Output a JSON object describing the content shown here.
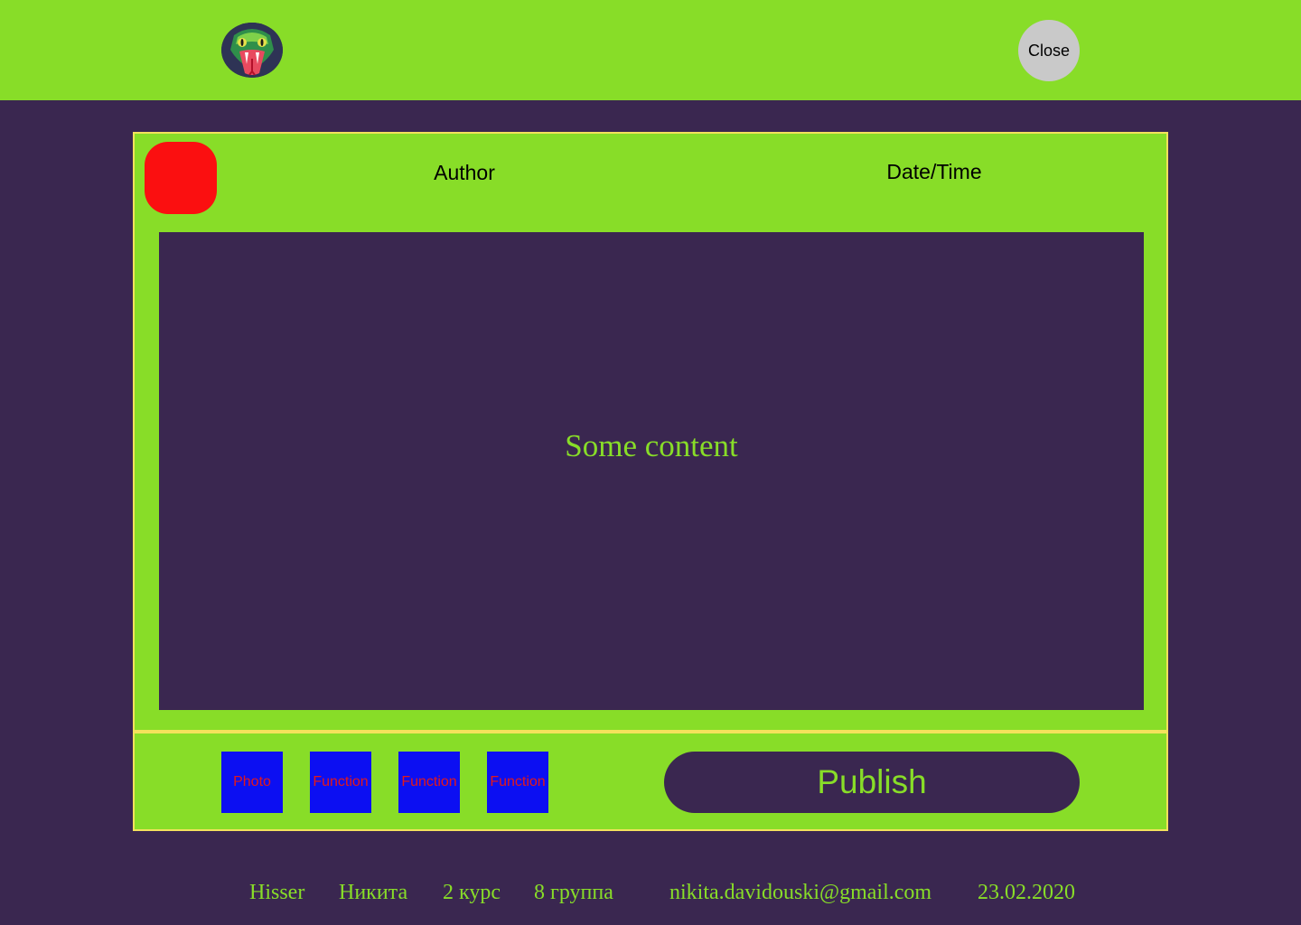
{
  "header": {
    "logo_icon": "snake-logo-icon",
    "close_label": "Close"
  },
  "post": {
    "avatar_color": "#fb0f10",
    "author_label": "Author",
    "datetime_label": "Date/Time",
    "content_text": "Some content"
  },
  "toolbar": {
    "buttons": [
      {
        "label": "Photo"
      },
      {
        "label": "Function"
      },
      {
        "label": "Function"
      },
      {
        "label": "Function"
      }
    ],
    "publish_label": "Publish"
  },
  "footer": {
    "app_name": "Hisser",
    "name": "Никита",
    "course": "2 курс",
    "group": "8 группа",
    "email": "nikita.davidouski@gmail.com",
    "date": "23.02.2020"
  },
  "colors": {
    "accent_green": "#88dd28",
    "background_purple": "#3a2750",
    "border_yellow": "#f3e25c",
    "tool_button_blue": "#0c0ff2",
    "tool_label_red": "#e31919"
  }
}
